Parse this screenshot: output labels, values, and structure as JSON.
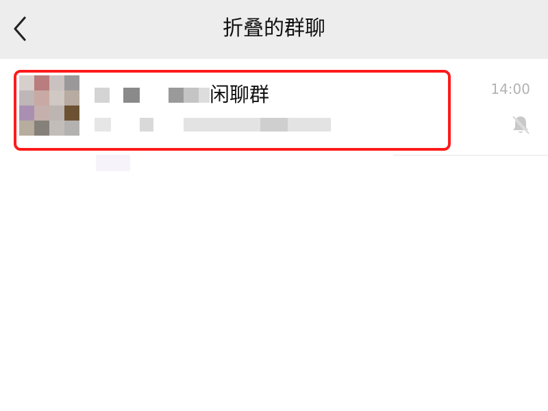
{
  "header": {
    "title": "折叠的群聊",
    "back_icon": "chevron-left-icon"
  },
  "chat": {
    "name_visible": "闲聊群",
    "time": "14:00",
    "muted": true,
    "mute_icon": "bell-slash-icon",
    "avatar_colors": [
      "#d7cfcc",
      "#b97d7d",
      "#c9c2c0",
      "#9a9898",
      "#bfb6b7",
      "#c9a9a3",
      "#cfc8c3",
      "#b8aba2",
      "#a990b2",
      "#c5b0ad",
      "#bdb5b1",
      "#6d5232",
      "#b6ad9f",
      "#858079",
      "#c2bdb9",
      "#b4b2b0"
    ]
  },
  "colors": {
    "header_bg": "#ededed",
    "highlight": "#ff1a1a",
    "time_text": "#b2b2b2"
  }
}
